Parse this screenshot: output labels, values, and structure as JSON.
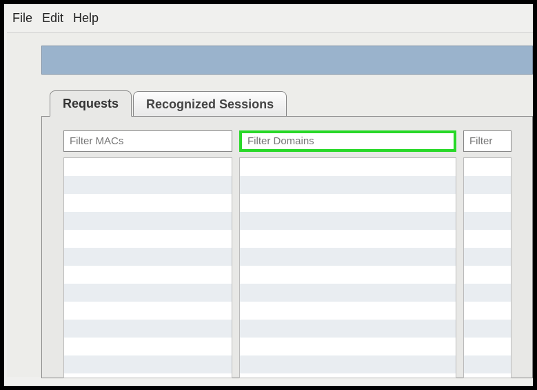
{
  "menu": {
    "file": "File",
    "edit": "Edit",
    "help": "Help"
  },
  "tabs": {
    "requests": "Requests",
    "recognized_sessions": "Recognized Sessions"
  },
  "filters": {
    "macs_placeholder": "Filter MACs",
    "domains_placeholder": "Filter Domains",
    "third_placeholder": "Filter"
  }
}
